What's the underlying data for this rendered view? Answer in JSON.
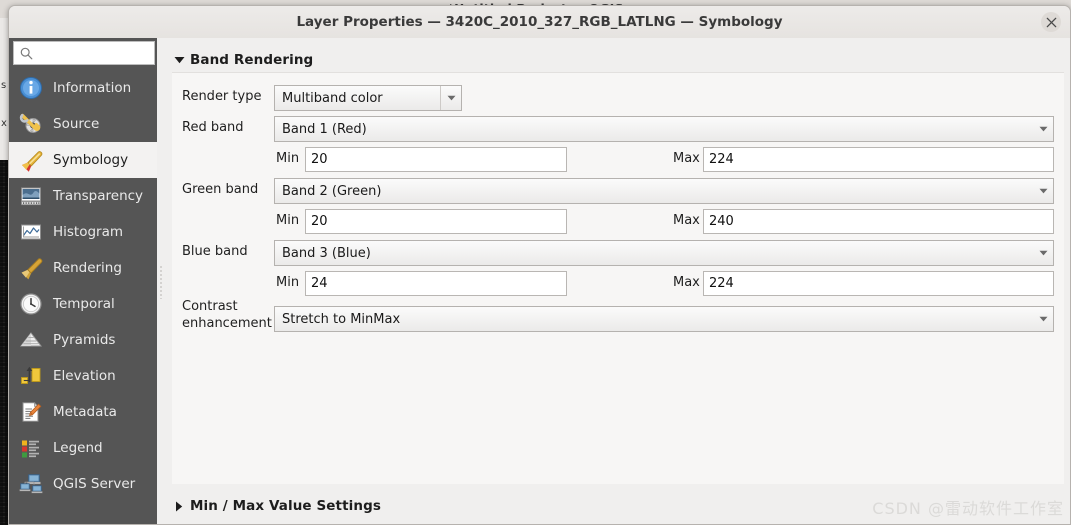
{
  "background_window": {
    "title": "*Untitled Project — QGIS",
    "left_panel_fragments": [
      "s",
      "x"
    ]
  },
  "dialog": {
    "title": "Layer Properties — 3420C_2010_327_RGB_LATLNG — Symbology",
    "close_icon": "close-icon"
  },
  "sidebar": {
    "search": {
      "value": "",
      "placeholder": "",
      "icon": "search-icon"
    },
    "items": [
      {
        "label": "Information",
        "icon": "information-icon",
        "selected": false
      },
      {
        "label": "Source",
        "icon": "source-wrench-icon",
        "selected": false
      },
      {
        "label": "Symbology",
        "icon": "symbology-brush-icon",
        "selected": true
      },
      {
        "label": "Transparency",
        "icon": "transparency-icon",
        "selected": false
      },
      {
        "label": "Histogram",
        "icon": "histogram-icon",
        "selected": false
      },
      {
        "label": "Rendering",
        "icon": "rendering-brush-icon",
        "selected": false
      },
      {
        "label": "Temporal",
        "icon": "clock-icon",
        "selected": false
      },
      {
        "label": "Pyramids",
        "icon": "pyramids-icon",
        "selected": false
      },
      {
        "label": "Elevation",
        "icon": "elevation-arrow-icon",
        "selected": false
      },
      {
        "label": "Metadata",
        "icon": "metadata-pencil-icon",
        "selected": false
      },
      {
        "label": "Legend",
        "icon": "legend-list-icon",
        "selected": false
      },
      {
        "label": "QGIS Server",
        "icon": "server-icon",
        "selected": false
      }
    ]
  },
  "content": {
    "groups": {
      "band_rendering": {
        "label": "Band Rendering",
        "expanded": true,
        "triangle": "triangle-down-icon"
      },
      "min_max_value_settings": {
        "label": "Min / Max Value Settings",
        "expanded": false,
        "triangle": "triangle-right-icon"
      }
    },
    "render_type": {
      "label": "Render type",
      "value": "Multiband color"
    },
    "bands": [
      {
        "label": "Red band",
        "value": "Band 1 (Red)",
        "min_label": "Min",
        "min_value": "20",
        "max_label": "Max",
        "max_value": "224"
      },
      {
        "label": "Green band",
        "value": "Band 2 (Green)",
        "min_label": "Min",
        "min_value": "20",
        "max_label": "Max",
        "max_value": "240"
      },
      {
        "label": "Blue band",
        "value": "Band 3 (Blue)",
        "min_label": "Min",
        "min_value": "24",
        "max_label": "Max",
        "max_value": "224"
      }
    ],
    "contrast_enhancement": {
      "label_line1": "Contrast",
      "label_line2": "enhancement",
      "value": "Stretch to MinMax"
    },
    "watermark": "CSDN @雷动软件工作室"
  },
  "colors": {
    "sidebar_bg": "#555555",
    "selected_item_bg": "#f3f2f1",
    "dialog_bg": "#f0efee",
    "panel_bg": "#f7f6f5",
    "text_dark": "#1f1f1f",
    "text_light": "#e9e9e9"
  }
}
